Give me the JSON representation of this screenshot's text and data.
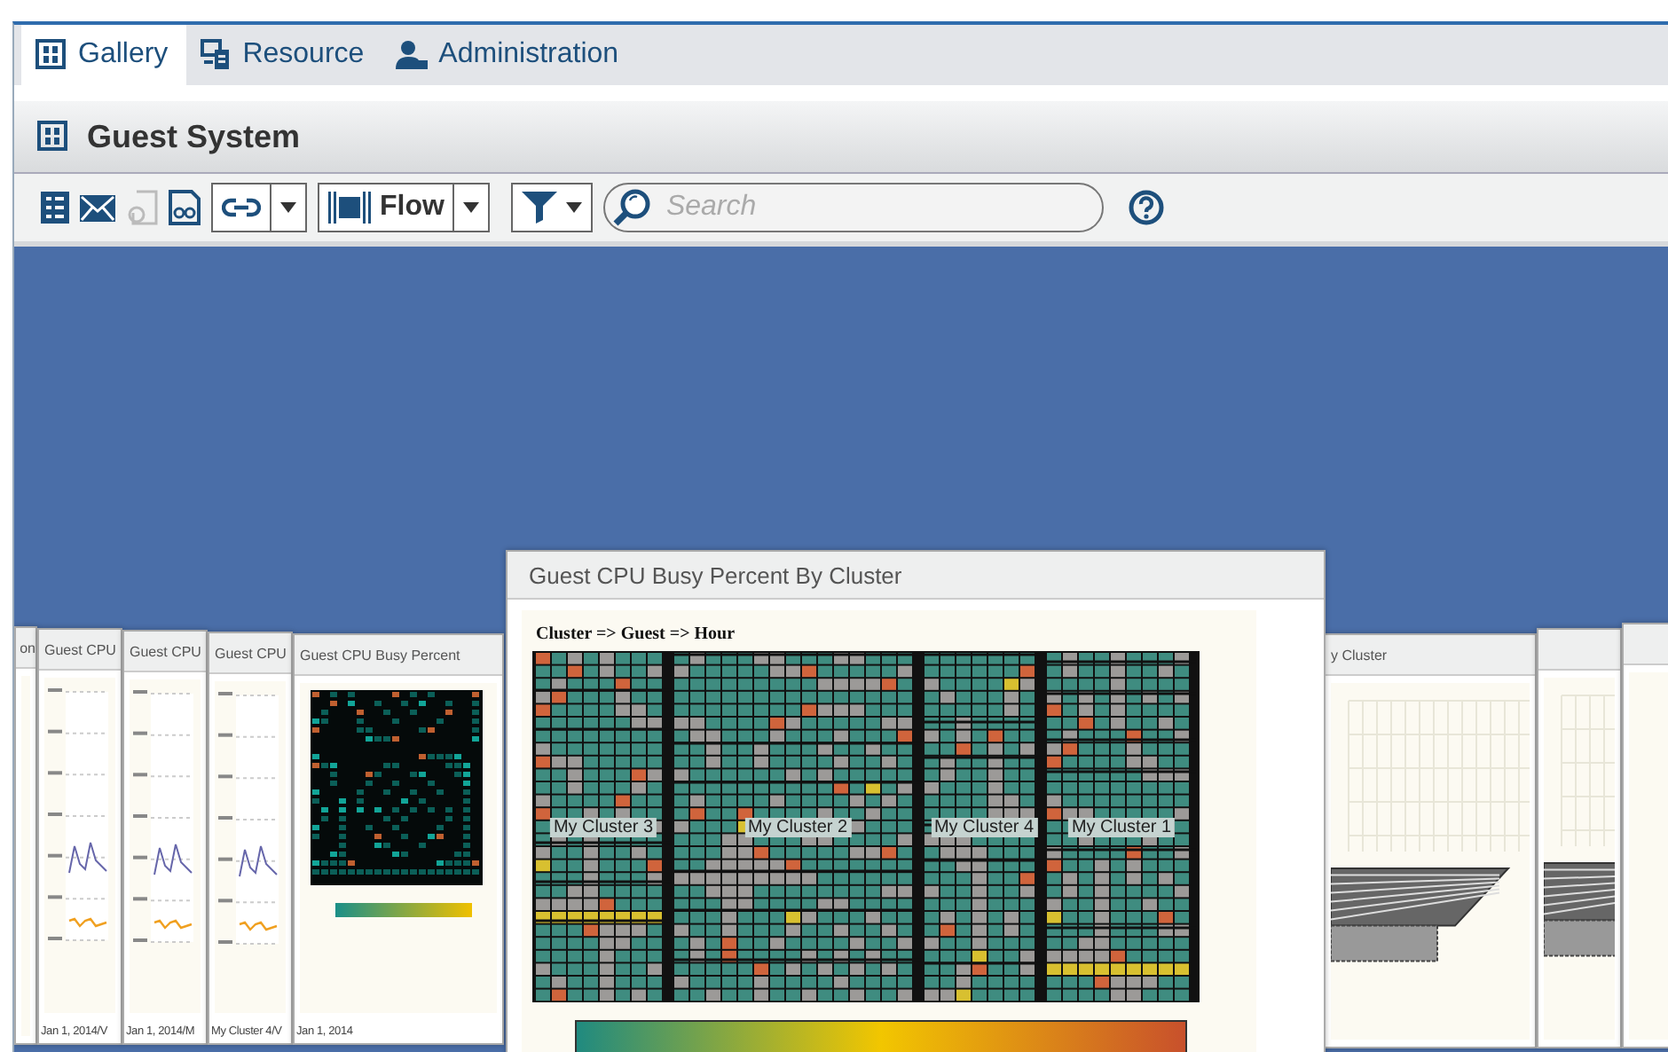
{
  "tabs": [
    {
      "label": "Gallery",
      "kind": "gallery",
      "selected": true
    },
    {
      "label": "Resource",
      "kind": "resource",
      "selected": false
    },
    {
      "label": "Administration",
      "kind": "admin",
      "selected": false
    }
  ],
  "header": {
    "title": "Guest System"
  },
  "toolbar": {
    "flow_label": "Flow",
    "search": {
      "placeholder": "Search"
    }
  },
  "gallery": {
    "left_cards": [
      {
        "kind": "blank",
        "title": "on"
      },
      {
        "kind": "line",
        "title": "Guest CPU",
        "footer": "Jan 1, 2014/V"
      },
      {
        "kind": "line",
        "title": "Guest CPU",
        "footer": "Jan 1, 2014/M"
      },
      {
        "kind": "line",
        "title": "Guest CPU",
        "footer": "My Cluster 4/V"
      },
      {
        "kind": "heatmap",
        "title": "Guest CPU Busy Percent",
        "footer": "Jan 1, 2014"
      }
    ],
    "featured": {
      "title": "Guest CPU Busy Percent By Cluster",
      "subtitle": "Cluster => Guest => Hour",
      "clusters": [
        {
          "label": "My Cluster 3"
        },
        {
          "label": "My Cluster 2"
        },
        {
          "label": "My Cluster 4"
        },
        {
          "label": "My Cluster 1"
        }
      ]
    },
    "right_cards": [
      {
        "kind": "surface",
        "title": "y Cluster"
      },
      {
        "kind": "surface"
      },
      {
        "kind": "blank"
      }
    ]
  }
}
